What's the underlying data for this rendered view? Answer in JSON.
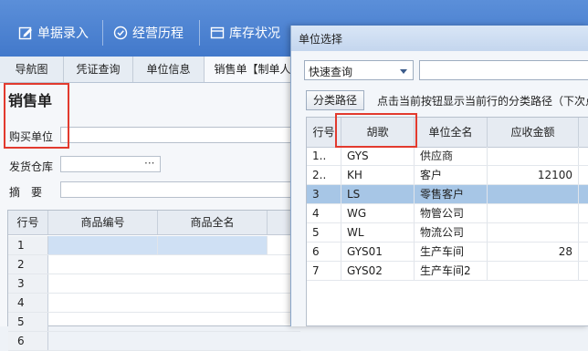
{
  "toolbar": {
    "items": [
      {
        "label": "单据录入",
        "icon": "edit-icon"
      },
      {
        "label": "经营历程",
        "icon": "history-icon"
      },
      {
        "label": "库存状况",
        "icon": "inventory-icon"
      }
    ]
  },
  "tabs": [
    "导航图",
    "凭证查询",
    "单位信息",
    "销售单【制单人"
  ],
  "form": {
    "title": "销售单",
    "buyer_label": "购买单位",
    "warehouse_label": "发货仓库",
    "summary_label": "摘　要",
    "dots": "···"
  },
  "left_grid": {
    "headers": [
      "行号",
      "商品编号",
      "商品全名"
    ],
    "rows": [
      "1",
      "2",
      "3",
      "4",
      "5",
      "6"
    ]
  },
  "dialog": {
    "title": "单位选择",
    "filter_value": "快速查询",
    "category_button": "分类路径",
    "hint": "点击当前按钮显示当前行的分类路径（下次点",
    "headers": [
      "行号",
      "胡歌",
      "单位全名",
      "应收金额"
    ],
    "rows": [
      {
        "no": "1..",
        "code": "GYS",
        "name": "供应商",
        "amount": ""
      },
      {
        "no": "2..",
        "code": "KH",
        "name": "客户",
        "amount": "12100"
      },
      {
        "no": "3",
        "code": "LS",
        "name": "零售客户",
        "amount": ""
      },
      {
        "no": "4",
        "code": "WG",
        "name": "物管公司",
        "amount": ""
      },
      {
        "no": "5",
        "code": "WL",
        "name": "物流公司",
        "amount": ""
      },
      {
        "no": "6",
        "code": "GYS01",
        "name": "生产车间",
        "amount": "28"
      },
      {
        "no": "7",
        "code": "GYS02",
        "name": "生产车间2",
        "amount": ""
      }
    ],
    "selected_row": 3
  },
  "colors": {
    "accent": "#4a80d0",
    "highlight": "#e23a2e",
    "selection": "#a7c6e6"
  }
}
